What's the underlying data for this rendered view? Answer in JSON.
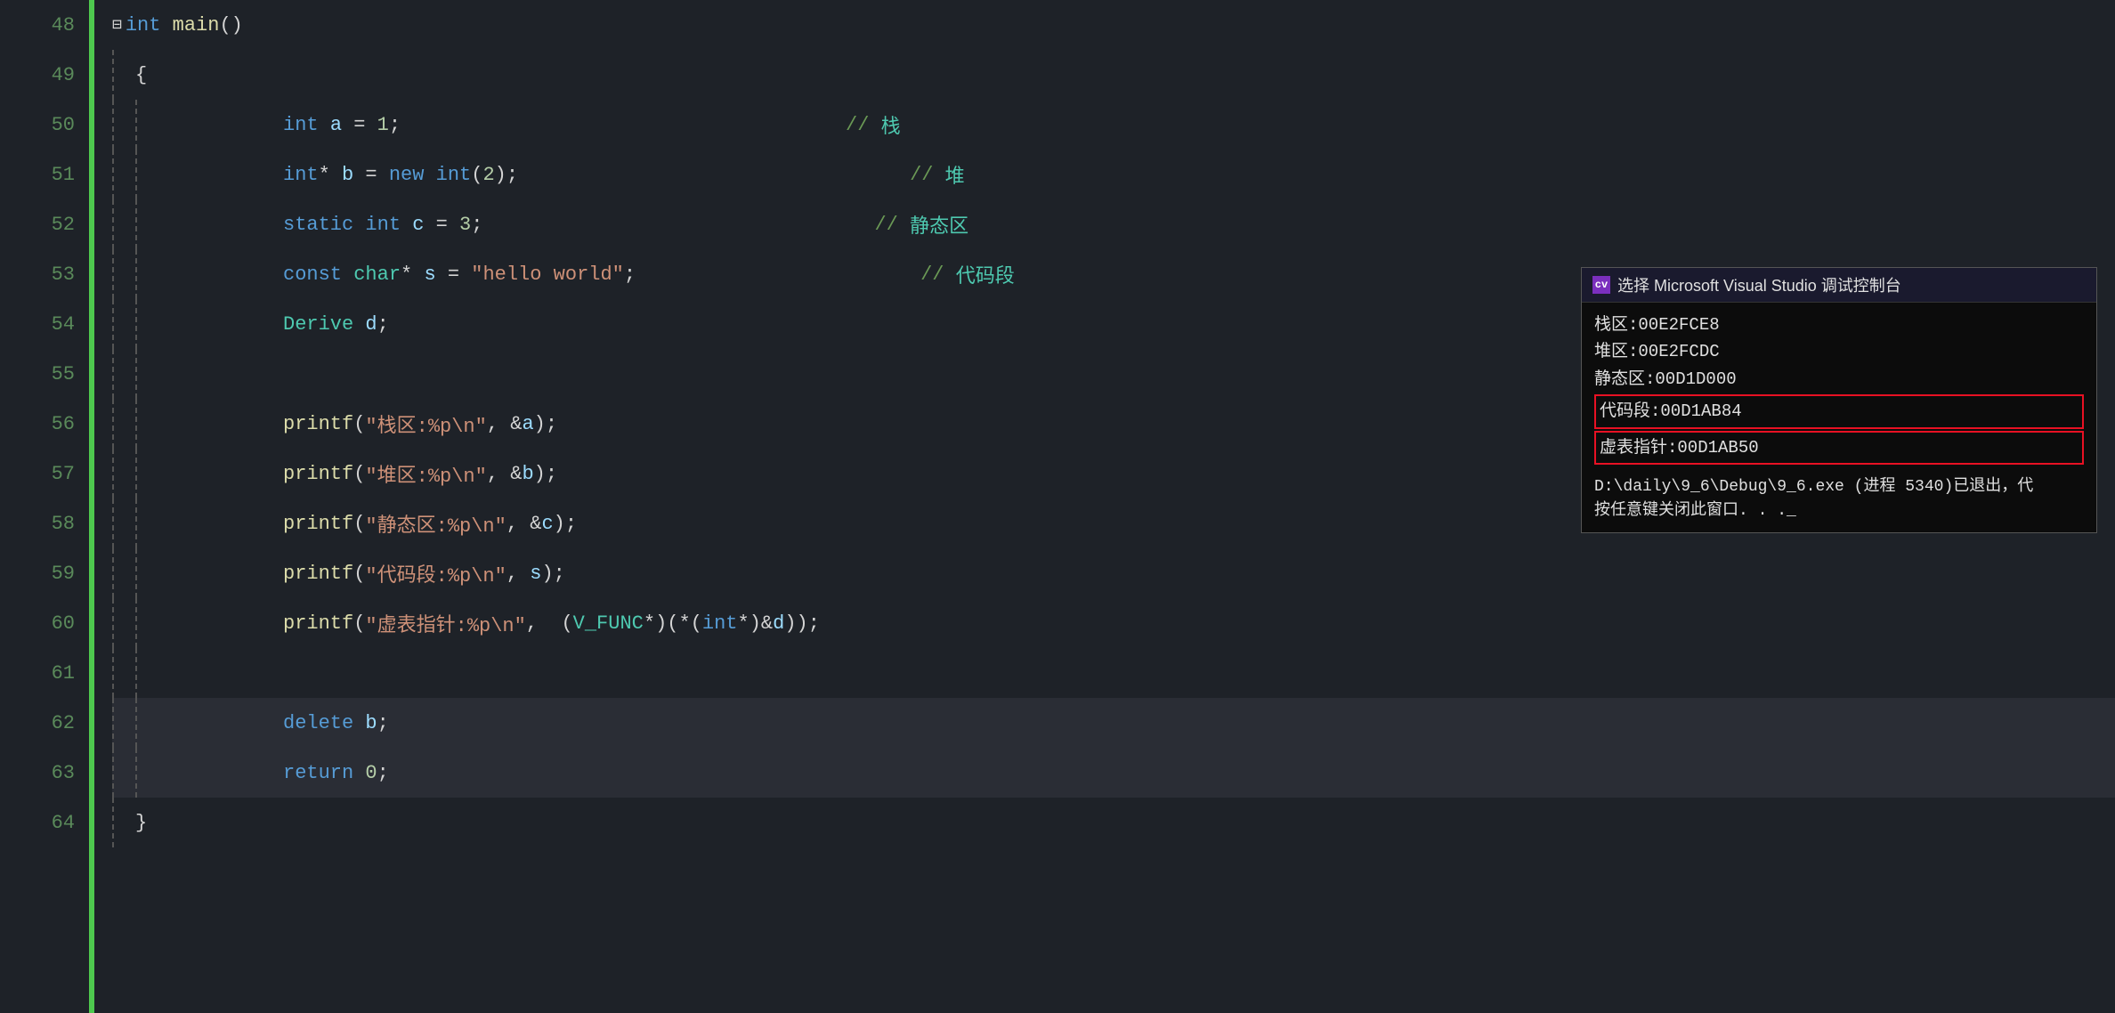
{
  "editor": {
    "background": "#1e2228",
    "lines": [
      {
        "num": 48,
        "content": "int_main_function",
        "raw": "⊟int main()"
      },
      {
        "num": 49,
        "content": "open_brace",
        "raw": "{"
      },
      {
        "num": 50,
        "content": "int_a",
        "raw": "    int a = 1;",
        "comment": "// 栈"
      },
      {
        "num": 51,
        "content": "int_b",
        "raw": "    int* b = new int(2);",
        "comment": "// 堆"
      },
      {
        "num": 52,
        "content": "static_c",
        "raw": "    static int c = 3;",
        "comment": "// 静态区"
      },
      {
        "num": 53,
        "content": "const_s",
        "raw": "    const char* s = \"hello world\";",
        "comment": "// 代码段"
      },
      {
        "num": 54,
        "content": "derive_d",
        "raw": "    Derive d;"
      },
      {
        "num": 55,
        "content": "empty",
        "raw": ""
      },
      {
        "num": 56,
        "content": "printf_a",
        "raw": "    printf(\"栈区:%p\\n\", &a);"
      },
      {
        "num": 57,
        "content": "printf_b",
        "raw": "    printf(\"堆区:%p\\n\", &b);"
      },
      {
        "num": 58,
        "content": "printf_c",
        "raw": "    printf(\"静态区:%p\\n\", &c);"
      },
      {
        "num": 59,
        "content": "printf_s",
        "raw": "    printf(\"代码段:%p\\n\", s);"
      },
      {
        "num": 60,
        "content": "printf_vtable",
        "raw": "    printf(\"虚表指针:%p\\n\",  (V_FUNC*)(*(int*)&d));"
      },
      {
        "num": 61,
        "content": "empty2",
        "raw": ""
      },
      {
        "num": 62,
        "content": "delete_b",
        "raw": "    delete b;",
        "highlighted": true
      },
      {
        "num": 63,
        "content": "return_0",
        "raw": "    return 0;",
        "highlighted": true
      },
      {
        "num": 64,
        "content": "close_brace",
        "raw": "}"
      }
    ]
  },
  "debug_console": {
    "title": "选择 Microsoft Visual Studio 调试控制台",
    "icon_text": "cv",
    "output": [
      {
        "text": "栈区:00E2FCE8",
        "highlighted": false
      },
      {
        "text": "堆区:00E2FCDC",
        "highlighted": false
      },
      {
        "text": "静态区:00D1D000",
        "highlighted": false
      },
      {
        "text": "代码段:00D1AB84",
        "highlighted": true
      },
      {
        "text": "虚表指针:00D1AB50",
        "highlighted": true
      }
    ],
    "path_line1": "D:\\daily\\9_6\\Debug\\9_6.exe (进程 5340)已退出，代",
    "path_line2": "按任意键关闭此窗口. . .",
    "cursor": "_"
  }
}
